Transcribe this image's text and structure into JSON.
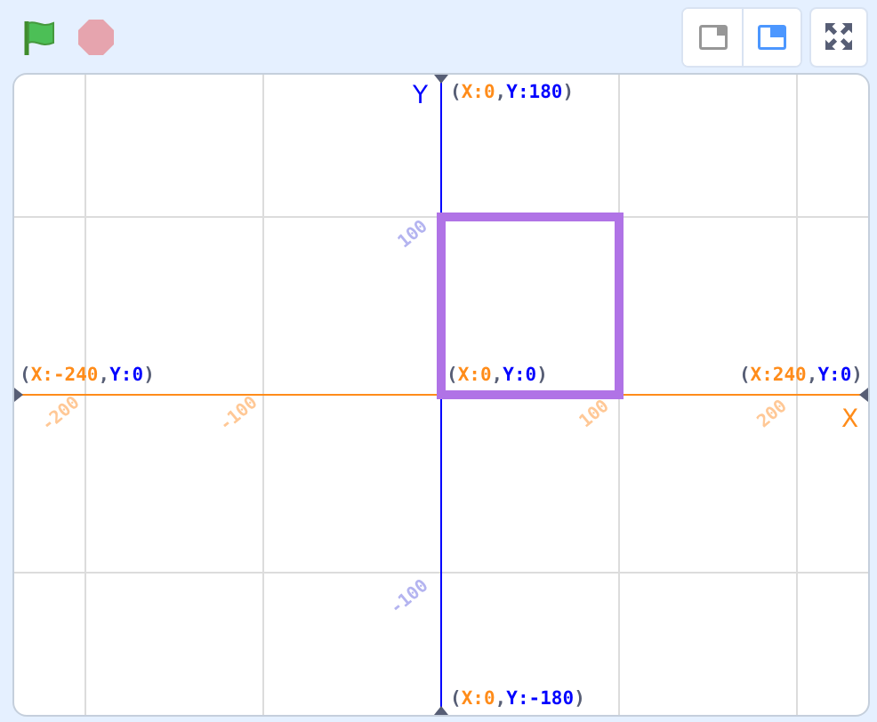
{
  "stage_size_buttons": [
    {
      "kind": "small",
      "selected": false
    },
    {
      "kind": "large",
      "selected": true
    }
  ],
  "stage": {
    "axes": [
      {
        "kind": "x",
        "letter": "X",
        "ticks": [
          "-200",
          "-100",
          "100",
          "200"
        ]
      },
      {
        "kind": "y",
        "letter": "Y",
        "ticks": [
          "100",
          "-100"
        ]
      }
    ],
    "coordinate_labels": [
      {
        "parts": [
          "(",
          "X:0",
          ",",
          "Y:180",
          ")"
        ]
      },
      {
        "parts": [
          "(",
          "X:-240",
          ",",
          "Y:0",
          ")"
        ]
      },
      {
        "parts": [
          "(",
          "X:0",
          ",",
          "Y:0",
          ")"
        ]
      },
      {
        "parts": [
          "(",
          "X:240",
          ",",
          "Y:0",
          ")"
        ]
      },
      {
        "parts": [
          "(",
          "X:0",
          ",",
          "Y:-180",
          ")"
        ]
      }
    ]
  }
}
